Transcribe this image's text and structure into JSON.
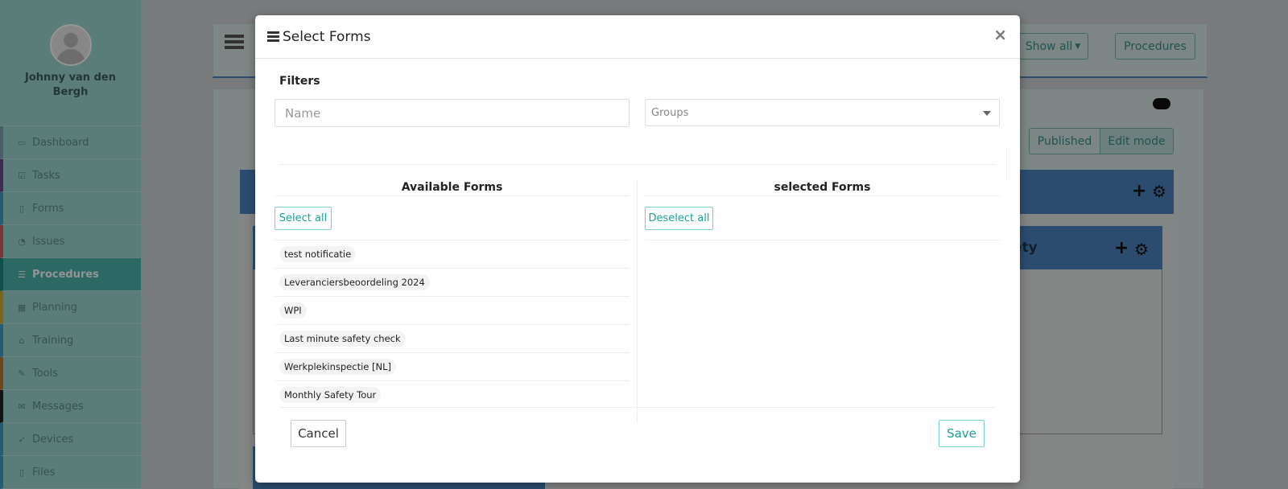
{
  "app": {
    "user_name": "Johnny van den Bergh",
    "nav": [
      {
        "label": "Dashboard",
        "icon": "monitor-icon",
        "accent": "#7ea3b5"
      },
      {
        "label": "Tasks",
        "icon": "checkbox-icon",
        "accent": "#6a4a8c"
      },
      {
        "label": "Forms",
        "icon": "document-icon",
        "accent": "#3d9fd0"
      },
      {
        "label": "Issues",
        "icon": "bell-icon",
        "accent": "#d06060"
      },
      {
        "label": "Procedures",
        "icon": "list-icon",
        "accent": "#1a8c80"
      },
      {
        "label": "Planning",
        "icon": "calendar-icon",
        "accent": "#d0b030"
      },
      {
        "label": "Training",
        "icon": "graduation-cap-icon",
        "accent": "#3d9fd0"
      },
      {
        "label": "Tools",
        "icon": "wrench-icon",
        "accent": "#c07830"
      },
      {
        "label": "Messages",
        "icon": "envelope-icon",
        "accent": "#222222"
      },
      {
        "label": "Devices",
        "icon": "rocket-icon",
        "accent": "#3d9fd0"
      },
      {
        "label": "Files",
        "icon": "file-icon",
        "accent": "#3d9fd0"
      }
    ],
    "active_nav": "Procedures",
    "header": {
      "show_all_label": "Show all",
      "procedures_label": "Procedures"
    },
    "mode_toggle": {
      "published_label": "Published",
      "edit_mode_label": "Edit mode"
    },
    "partial_text": "ety"
  },
  "modal": {
    "title": "Select Forms",
    "close_label": "×",
    "filters_label": "Filters",
    "name_placeholder": "Name",
    "groups_placeholder": "Groups",
    "available_title": "Available Forms",
    "selected_title": "selected Forms",
    "select_all_label": "Select all",
    "deselect_all_label": "Deselect all",
    "available_forms": [
      "test notificatie",
      "Leveranciersbeoordeling 2024",
      "WPI",
      "Last minute safety check",
      "Werkplekinspectie [NL]",
      "Monthly Safety Tour"
    ],
    "selected_forms": [],
    "cancel_label": "Cancel",
    "save_label": "Save"
  },
  "colors": {
    "accent": "#1aa39a",
    "sidebar": "#9dd7d2",
    "active_nav": "#4db3ad",
    "panel_blue": "#4a83bd"
  }
}
